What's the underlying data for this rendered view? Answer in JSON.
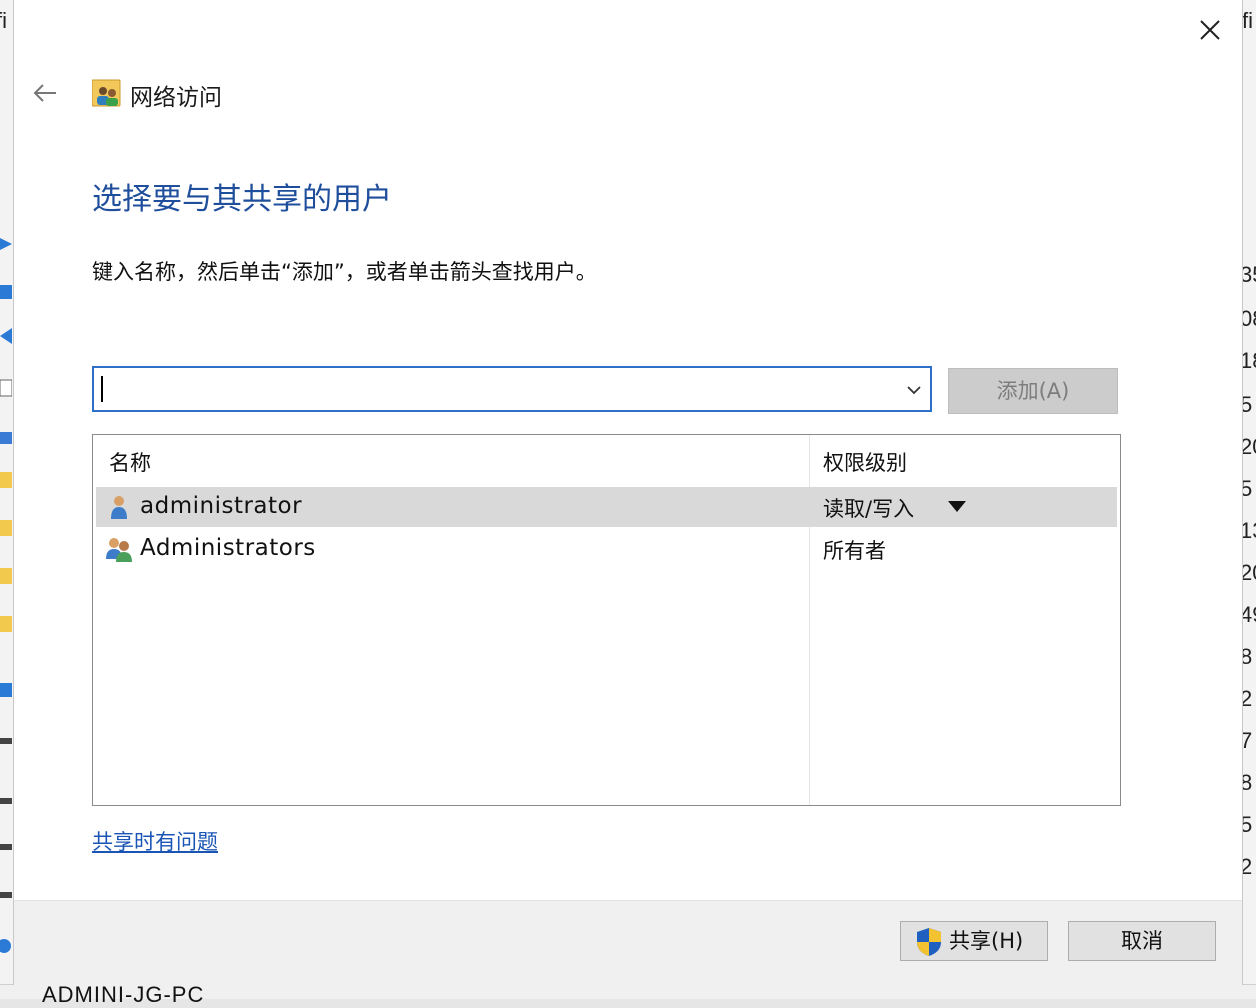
{
  "dialog": {
    "title": "网络访问",
    "heading": "选择要与其共享的用户",
    "instruction": "键入名称，然后单击“添加”，或者单击箭头查找用户。",
    "combo": {
      "value": "",
      "placeholder": ""
    },
    "add_button": "添加(A)",
    "list": {
      "columns": {
        "name": "名称",
        "permission": "权限级别"
      },
      "rows": [
        {
          "name": "administrator",
          "permission": "读取/写入",
          "icon": "user-icon",
          "selected": true
        },
        {
          "name": "Administrators",
          "permission": "所有者",
          "icon": "user-group-icon",
          "selected": false
        }
      ]
    },
    "help_link": "共享时有问题",
    "share_button": "共享(H)",
    "cancel_button": "取消"
  },
  "background": {
    "bottom_text": "ADMINI-JG-PC",
    "left_fragment": "fi",
    "right_fragment": "fi",
    "right_digits": [
      "35",
      "08",
      "18",
      "5",
      "20",
      "5",
      "13",
      "20",
      "49",
      "8",
      "2",
      "7",
      "8",
      "5",
      "2"
    ]
  },
  "colors": {
    "heading": "#1f4e9c",
    "link": "#1a55b5",
    "combo_border": "#2d6fc9",
    "selected_row": "#d9d9d9"
  }
}
